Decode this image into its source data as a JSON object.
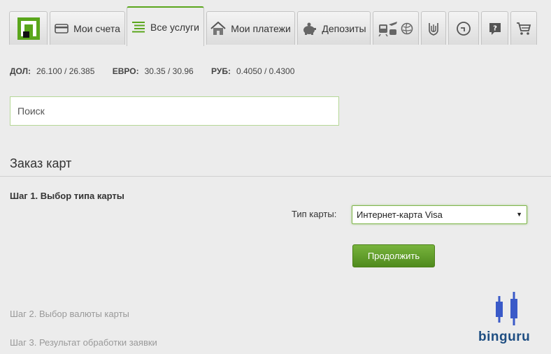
{
  "tabs": [
    {
      "label": "Мои счета"
    },
    {
      "label": "Все услуги"
    },
    {
      "label": "Мои платежи"
    },
    {
      "label": "Депозиты"
    }
  ],
  "rates": {
    "usd_label": "ДОЛ:",
    "usd_value": "26.100 / 26.385",
    "eur_label": "ЕВРО:",
    "eur_value": "30.35 / 30.96",
    "rub_label": "РУБ:",
    "rub_value": "0.4050 / 0.4300"
  },
  "search": {
    "placeholder": "Поиск"
  },
  "section": {
    "title": "Заказ карт"
  },
  "step1": {
    "title": "Шаг 1. Выбор типа карты",
    "card_type_label": "Тип карты:",
    "card_type_value": "Интернет-карта Visa",
    "continue_label": "Продолжить"
  },
  "step2": {
    "title": "Шаг 2. Выбор валюты карты"
  },
  "step3": {
    "title": "Шаг 3. Результат обработки заявки"
  },
  "brand": {
    "text": "binguru"
  },
  "colors": {
    "accent": "#5aa61c",
    "button": "#5f9a27",
    "muted_text": "#999999",
    "brand": "#1e4e82",
    "candle": "#3a5ac8"
  }
}
